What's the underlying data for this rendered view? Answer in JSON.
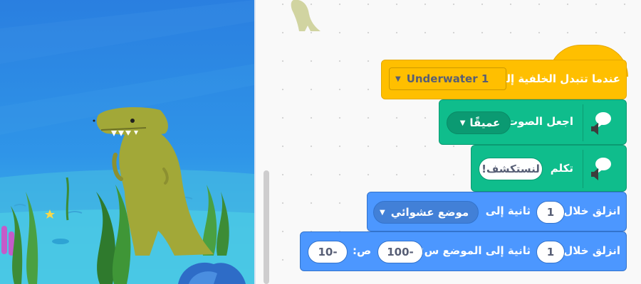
{
  "backdrop": {
    "name": "Underwater 1"
  },
  "blocks": {
    "when_backdrop": {
      "label": "عندما تتبدل الخلفية إلى",
      "menu_value": "Underwater 1"
    },
    "set_voice": {
      "label": "اجعل الصوت",
      "menu_value": "عميقًا"
    },
    "speak": {
      "label": "تكلم",
      "value": "لنستكشف!"
    },
    "glide_to": {
      "label_1": "انزلق خلال",
      "secs": "1",
      "label_2": "ثانية إلى",
      "menu_value": "موضع عشوائي"
    },
    "glide_xy": {
      "label_1": "انزلق خلال",
      "secs": "1",
      "label_2": "ثانية إلى الموضع س:",
      "x": "-100",
      "label_3": "ص:",
      "y": "-10"
    }
  },
  "colors": {
    "events": "#ffbf00",
    "text_to_speech": "#0fbd8c",
    "motion": "#4c97ff",
    "stage_water": "#2e8ae6",
    "dino": "#a2a838"
  },
  "icons": {
    "speech_extension": "speech-bubble-speaker-icon",
    "dropdown": "triangle-down-icon"
  }
}
